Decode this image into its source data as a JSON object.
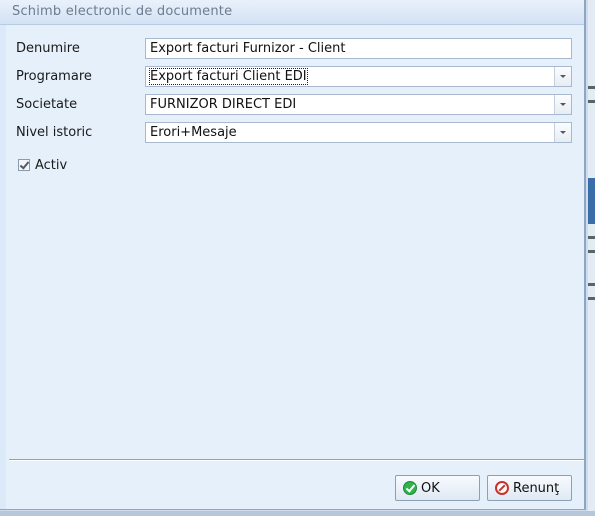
{
  "window": {
    "title": "Schimb electronic de documente"
  },
  "form": {
    "name_label": "Denumire",
    "name_value": "Export facturi Furnizor - Client",
    "schedule_label": "Programare",
    "schedule_value": "Export facturi Client EDI",
    "company_label": "Societate",
    "company_value": "FURNIZOR DIRECT EDI",
    "history_label": "Nivel istoric",
    "history_value": "Erori+Mesaje",
    "active_label": "Activ",
    "active_checked": true
  },
  "buttons": {
    "ok_label": "OK",
    "cancel_label": "Renunţ"
  },
  "icons": {
    "ok": "check-circle-icon",
    "cancel": "no-entry-icon",
    "dropdown": "chevron-down-icon"
  },
  "colors": {
    "ok_icon": "#2fb34a",
    "cancel_icon": "#c7322b",
    "dialog_bg": "#e6f0fb"
  }
}
